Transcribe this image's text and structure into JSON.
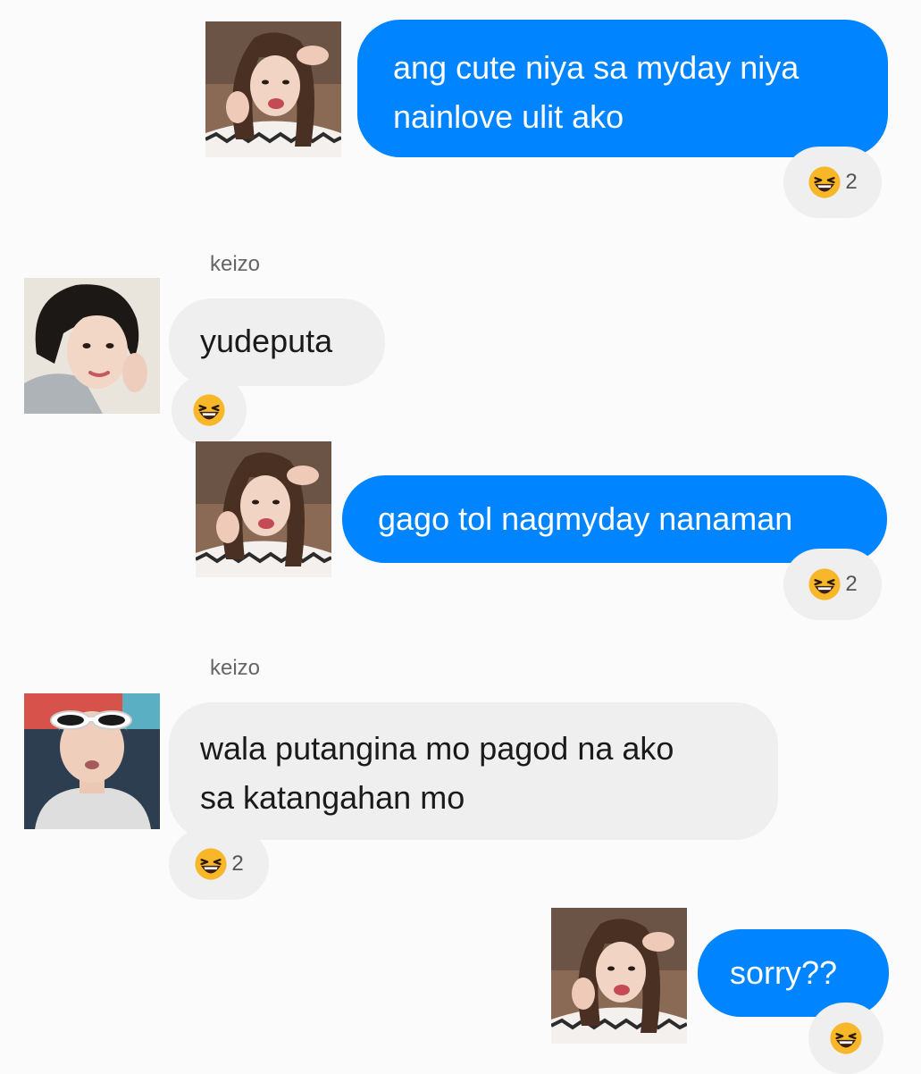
{
  "theme": {
    "sent_bubble": "#0084ff",
    "received_bubble": "#efefef",
    "reaction_emoji": "laughing-face-icon"
  },
  "messages": [
    {
      "direction": "sent",
      "sender_photo": "photo-long-hair-girl",
      "text": "ang cute niya sa myday niya\nnainlove ulit ako",
      "reaction_count": "2"
    },
    {
      "direction": "received",
      "sender": "keizo",
      "sender_photo": "photo-short-hair-girl",
      "text": "yudeputa",
      "reaction_count": ""
    },
    {
      "direction": "sent",
      "sender_photo": "photo-long-hair-girl",
      "text": "gago tol nagmyday nanaman",
      "reaction_count": "2"
    },
    {
      "direction": "received",
      "sender": "keizo",
      "sender_photo": "photo-guy-white-sunglasses",
      "text": "wala putangina mo pagod na ako\nsa katangahan mo",
      "reaction_count": "2"
    },
    {
      "direction": "sent",
      "sender_photo": "photo-long-hair-girl",
      "text": "sorry??",
      "reaction_count": ""
    }
  ]
}
